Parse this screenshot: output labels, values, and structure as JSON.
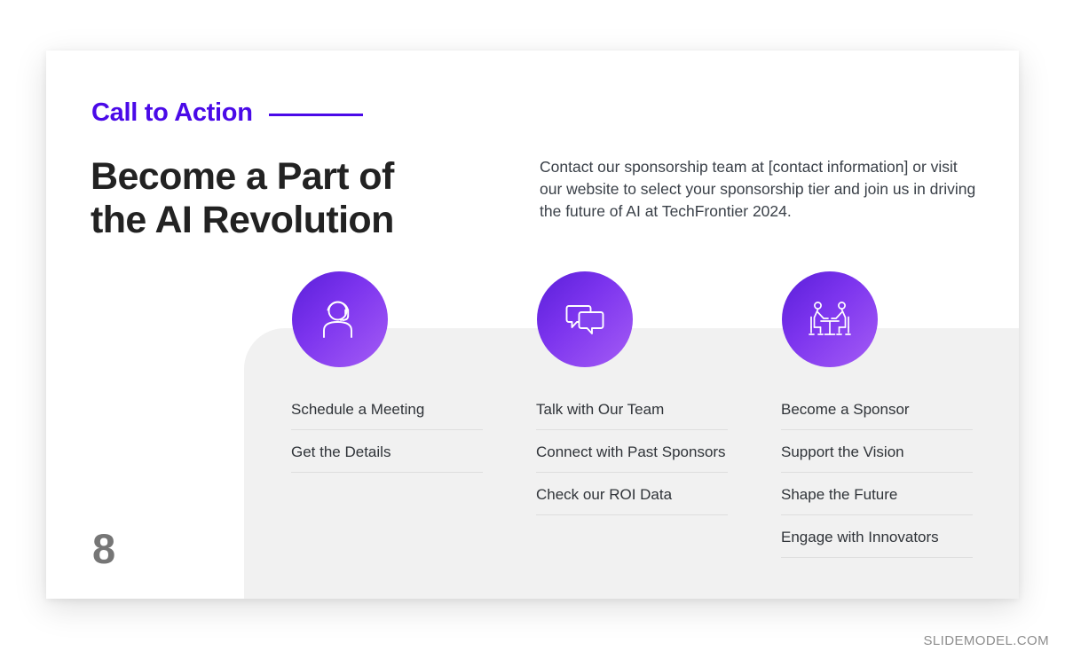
{
  "slide": {
    "eyebrow": "Call to Action",
    "headline": "Become a Part of the AI Revolution",
    "intro": "Contact our sponsorship team at [contact information] or visit our website to select your sponsorship tier and join us in driving the future of AI at TechFrontier 2024.",
    "page_number": "8",
    "footer": "SLIDEMODEL.COM"
  },
  "colors": {
    "accent": "#4a0ae8",
    "gradient_start": "#5a1fd9",
    "gradient_end": "#a45cf5",
    "heading": "#222222",
    "panel": "#f1f1f1",
    "divider": "#dedede",
    "page_number": "#767676"
  },
  "columns": [
    {
      "icon": "support-agent-headset-icon",
      "items": [
        "Schedule a Meeting",
        "Get the Details"
      ]
    },
    {
      "icon": "chat-bubbles-icon",
      "items": [
        "Talk with Our Team",
        "Connect with Past Sponsors",
        "Check our ROI Data"
      ]
    },
    {
      "icon": "meeting-table-people-icon",
      "items": [
        "Become a Sponsor",
        "Support the Vision",
        "Shape the Future",
        "Engage with Innovators"
      ]
    }
  ]
}
